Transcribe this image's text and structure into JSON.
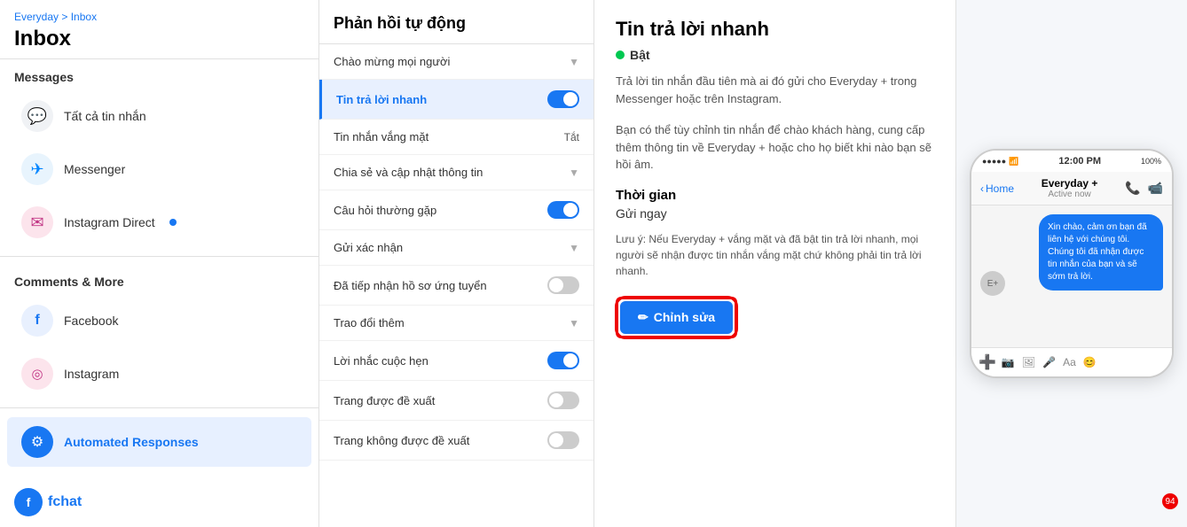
{
  "breadcrumb": {
    "parent": "Everyday",
    "separator": " > ",
    "current": "Inbox"
  },
  "page_title": "Inbox",
  "sections": {
    "messages_label": "Messages",
    "comments_label": "Comments & More"
  },
  "sidebar": {
    "items": [
      {
        "id": "all-messages",
        "label": "Tất cả tin nhắn",
        "icon": "💬",
        "type": "all-msg"
      },
      {
        "id": "messenger",
        "label": "Messenger",
        "icon": "✈",
        "type": "messenger"
      },
      {
        "id": "instagram-direct",
        "label": "Instagram Direct",
        "icon": "✉",
        "type": "instagram",
        "has_dot": true
      }
    ],
    "bottom_items": [
      {
        "id": "facebook",
        "label": "Facebook",
        "icon": "f",
        "type": "facebook"
      },
      {
        "id": "instagram",
        "label": "Instagram",
        "icon": "◎",
        "type": "instagram"
      },
      {
        "id": "automated-responses",
        "label": "Automated Responses",
        "icon": "⚙",
        "type": "automated",
        "active": true
      }
    ]
  },
  "fchat": {
    "logo_text": "fchat"
  },
  "notification_count": "94",
  "middle_panel": {
    "title": "Phản hồi tự động",
    "items": [
      {
        "id": "chao-mung",
        "label": "Chào mừng mọi người",
        "type": "chevron",
        "active": false
      },
      {
        "id": "tin-tra-loi-nhanh",
        "label": "Tin trả lời nhanh",
        "type": "toggle",
        "toggle_on": true,
        "active": true
      },
      {
        "id": "tin-nhan-vang-mat",
        "label": "Tin nhắn vắng mặt",
        "type": "status",
        "status_text": "Tắt"
      },
      {
        "id": "chia-se",
        "label": "Chia sẻ và cập nhật thông tin",
        "type": "chevron",
        "active": false
      },
      {
        "id": "cau-hoi",
        "label": "Câu hỏi thường gặp",
        "type": "toggle",
        "toggle_on": true,
        "active": false
      },
      {
        "id": "gui-xac-nhan",
        "label": "Gửi xác nhận",
        "type": "chevron",
        "active": false
      },
      {
        "id": "da-tiep-nhan",
        "label": "Đã tiếp nhận hồ sơ ứng tuyển",
        "type": "toggle",
        "toggle_on": false,
        "active": false
      },
      {
        "id": "trao-doi-them",
        "label": "Trao đổi thêm",
        "type": "chevron",
        "active": false
      },
      {
        "id": "loi-nhac",
        "label": "Lời nhắc cuộc hẹn",
        "type": "toggle",
        "toggle_on": true,
        "active": false
      },
      {
        "id": "trang-de-xuat",
        "label": "Trang được đề xuất",
        "type": "toggle",
        "toggle_on": false,
        "active": false
      },
      {
        "id": "trang-khong-de-xuat",
        "label": "Trang không được đề xuất",
        "type": "toggle",
        "toggle_on": false,
        "active": false
      }
    ]
  },
  "detail": {
    "title": "Tin trả lời nhanh",
    "status": "Bật",
    "description1": "Trả lời tin nhắn đầu tiên mà ai đó gửi cho Everyday + trong Messenger hoặc trên Instagram.",
    "description2": "Bạn có thể tùy chỉnh tin nhắn để chào khách hàng, cung cấp thêm thông tin về Everyday + hoặc cho họ biết khi nào bạn sẽ hồi âm.",
    "time_section": "Thời gian",
    "time_value": "Gửi ngay",
    "note": "Lưu ý: Nếu Everyday + vắng mặt và đã bật tin trả lời nhanh, mọi người sẽ nhận được tin nhắn vắng mặt chứ không phải tin trả lời nhanh.",
    "edit_button_label": "✏ Chỉnh sửa"
  },
  "phone_preview": {
    "time": "12:00 PM",
    "battery": "100%",
    "contact_name": "Everyday +",
    "contact_status": "Active now",
    "back_label": "Home",
    "message": "Xin chào, cảm ơn bạn đã liên hệ với chúng tôi. Chúng tôi đã nhận được tin nhắn của bạn và sẽ sớm trả lời.",
    "icons_bottom": [
      "➕",
      "📷",
      "🖼",
      "🎤",
      "Aa",
      "😊"
    ]
  }
}
